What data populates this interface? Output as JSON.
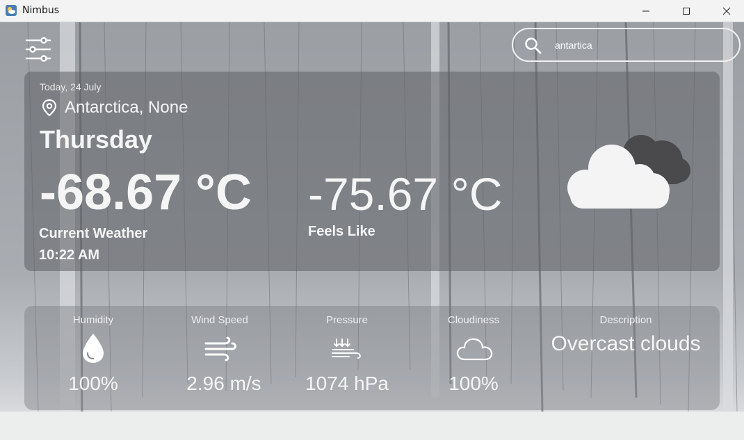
{
  "window": {
    "title": "Nimbus",
    "app_icon": "weather-app-icon"
  },
  "search": {
    "value": "antartica",
    "icon": "search-icon"
  },
  "current": {
    "date": "Today, 24 July",
    "location": "Antarctica, None",
    "day": "Thursday",
    "temperature": "-68.67 °C",
    "label": "Current Weather",
    "time": "10:22 AM",
    "feels_like_value": "-75.67 °C",
    "feels_like_label": "Feels Like",
    "condition_icon": "overcast-clouds-icon"
  },
  "stats": {
    "humidity_label": "Humidity",
    "humidity_value": "100%",
    "wind_label": "Wind Speed",
    "wind_value": "2.96 m/s",
    "pressure_label": "Pressure",
    "pressure_value": "1074 hPa",
    "cloudiness_label": "Cloudiness",
    "cloudiness_value": "100%",
    "description_label": "Description",
    "description_value": "Overcast clouds"
  },
  "colors": {
    "panel": "#5f6165",
    "text": "#f5f5f5",
    "titlebar": "#f3f3f3"
  }
}
